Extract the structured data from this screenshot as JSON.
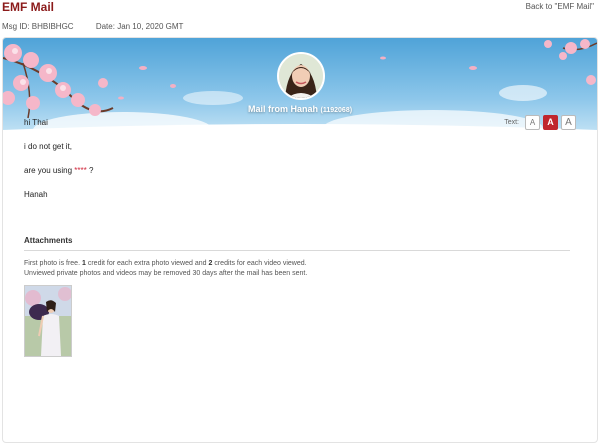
{
  "header": {
    "app_title": "EMF Mail",
    "back_link": "Back to \"EMF Mail\"",
    "msg_id_label": "Msg ID:",
    "msg_id": "BHBIBHGC",
    "date_label": "Date:",
    "date": "Jan 10, 2020 GMT"
  },
  "banner": {
    "title_prefix": "Mail from",
    "sender_name": "Hanah",
    "sender_id": "(1192068)"
  },
  "text_size": {
    "label": "Text:",
    "small": "A",
    "medium": "A",
    "large": "A",
    "selected": "medium"
  },
  "message": {
    "line1": "hi Thai",
    "line2": "i do not get it,",
    "line3_prefix": "are you using",
    "line3_censored": "****",
    "line3_suffix": "?",
    "signature": "Hanah"
  },
  "attachments": {
    "title": "Attachments",
    "note_part1": "First photo is free.",
    "credit_single": "1",
    "note_part2": "credit for each extra photo viewed and",
    "credit_video": "2",
    "note_part3": "credits for each video viewed.",
    "note_line2": "Unviewed private photos and videos may be removed 30 days after the mail has been sent.",
    "photos": [
      "photo-1"
    ]
  },
  "colors": {
    "brand": "#8b1a1a",
    "accent_red": "#c0262d",
    "censored_red": "#d0263a",
    "sky_blue": "#4fa3d8"
  }
}
